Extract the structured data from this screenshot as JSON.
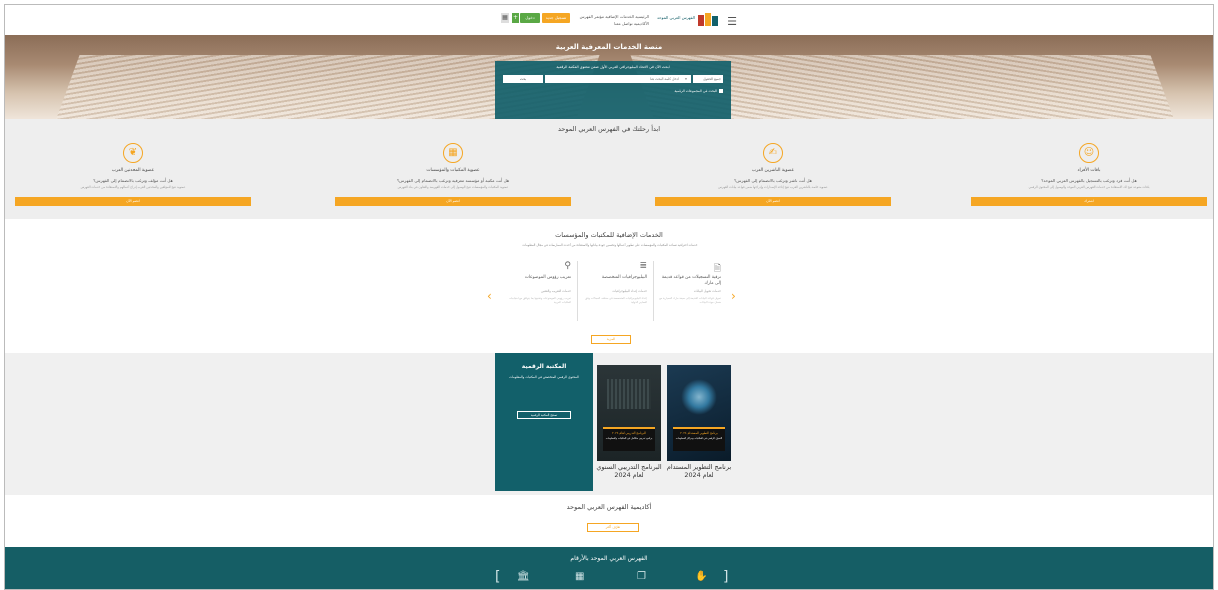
{
  "nav": {
    "menu_icon": "menu-icon",
    "logo_text": "الفهرس العربي الموحد",
    "links": [
      "الرئيسية",
      "الخدمات الإضافية",
      "مؤتمر الفهرس",
      "الأكاديمية",
      "تواصل معنا"
    ],
    "register_label": "تسجيل جديد",
    "login_label": "دخول",
    "plus_label": "+",
    "grid_label": "▦"
  },
  "hero": {
    "title": "منصة الخدمات المعرفية العربية",
    "search_heading": "ابحث الآن في الاتحاد الببليوجرافي العربي الأول ضمن محتوى المكتبة الرقمية",
    "select_label": "جميع الحقول",
    "select2_label": "▾",
    "search_placeholder": "ادخل كلمة البحث هنا",
    "search_button": "بحث",
    "check_label": "البحث في المجموعات الرقمية"
  },
  "start": {
    "title": "ابدأ رحلتك في الفهرس العربي الموحد",
    "cards": [
      {
        "icon": "user-icon",
        "title": "باقات الأفراد",
        "question": "هل أنت فرد وترغب بالتسجيل بالفهرس العربي الموحد؟",
        "desc": "باقات متنوعة تتيح لك الاستفادة من خدمات الفهرس العربي الموحد والوصول إلى المحتوى الرقمي",
        "button": "اشترك"
      },
      {
        "icon": "publisher-icon",
        "title": "عضوية الناشرين العرب",
        "question": "هل أنت ناشر وترغب بالانضمام إلى الفهرس؟",
        "desc": "عضوية خاصة بالناشرين العرب تتيح إتاحة الإصدارات وإدراجها ضمن قواعد بيانات الفهرس",
        "button": "انضم الآن"
      },
      {
        "icon": "library-icon",
        "title": "عضوية المكتبات والمؤسسات",
        "question": "هل أنت مكتبة أو مؤسسة معرفية وترغب بالانضمام إلى الفهرس؟",
        "desc": "عضوية المكتبات والمؤسسات تتيح الوصول إلى خدمات الفهرسة والتعاون في بناء الفهرس",
        "button": "انضم الآن"
      },
      {
        "icon": "archive-icon",
        "title": "عضوية المحدثين العرب",
        "question": "هل أنت مؤلف وترغب بالانضمام إلى الفهرس؟",
        "desc": "عضوية تتيح للمؤلفين والمحدثين العرب إدراج أعمالهم والاستفادة من خدمات الفهرس",
        "button": "انضم الآن"
      }
    ]
  },
  "services": {
    "title": "الخدمات الإضافية للمكتبات والمؤسسات",
    "subtitle": "خدمات احترافية تساعد المكتبات والمؤسسات على تطوير أعمالها وتحسين جودة بياناتها والاستفادة من أحدث الممارسات في مجال المعلومات",
    "items": [
      {
        "icon": "document-icon",
        "title": "ترقية التسجيلات من قواعد قديمة إلى مارك",
        "sub": "خدمات تحويل البيانات",
        "desc": "تحويل قواعد البيانات القديمة إلى صيغة مارك المعيارية مع ضمان جودة البيانات"
      },
      {
        "icon": "books-icon",
        "title": "الببليوجرافيات المتخصصة",
        "sub": "خدمات إعداد الببليوجرافيات",
        "desc": "إعداد الببليوجرافيات المتخصصة في مختلف المجالات وفق المعايير الدولية"
      },
      {
        "icon": "tag-icon",
        "title": "تعريب رؤوس الموضوعات",
        "sub": "خدمات التعريب والتقنين",
        "desc": "تعريب رؤوس الموضوعات وتقنينها بما يتوافق مع احتياجات المكتبات العربية"
      }
    ],
    "more_label": "المزيد"
  },
  "library": {
    "title": "المكتبة الرقمية",
    "subtitle": "المحتوى الرقمي المتخصص في المكتبات والمعلومات",
    "button": "تصفح المكتبة الرقمية",
    "books": [
      {
        "band_title": "البرنامج التدريبي لعام ٢٠٢٤",
        "band_sub": "برنامج تدريبي متكامل في المكتبات والمعلومات",
        "caption": "البرنامج التدريبي السنوي لعام 2024"
      },
      {
        "band_title": "برنامج التطوير المستدام ٢٠٢٤",
        "band_sub": "التحول الرقمي في المكتبات ومراكز المعلومات",
        "caption": "برنامج التطوير المستدام لعام 2024"
      }
    ]
  },
  "academy": {
    "title": "أكاديمية الفهرس العربي الموحد",
    "button": "تعرّف أكثر"
  },
  "footer": {
    "title": "الفهرس العربي الموحد بالأرقام",
    "icons": [
      "bank-icon",
      "building-icon",
      "document-stack-icon",
      "handshake-icon"
    ]
  },
  "colors": {
    "accent": "#f5a623",
    "primary": "#12606a",
    "footer": "#155e65",
    "success": "#5aa845"
  }
}
